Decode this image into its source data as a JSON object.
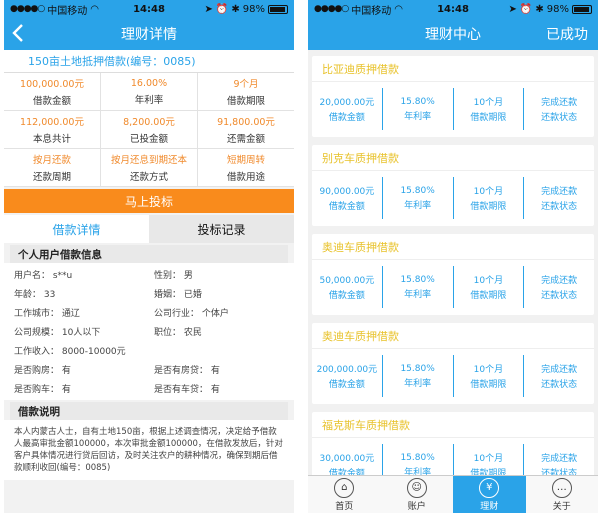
{
  "status": {
    "carrier": "中国移动",
    "time": "14:48",
    "battery": "98%"
  },
  "left": {
    "nav_title": "理财详情",
    "loan_title": "150亩土地抵押借款(编号：0085)",
    "stats": [
      [
        {
          "value": "100,000.00元",
          "label": "借款金额"
        },
        {
          "value": "16.00%",
          "label": "年利率"
        },
        {
          "value": "9个月",
          "label": "借款期限"
        }
      ],
      [
        {
          "value": "112,000.00元",
          "label": "本息共计"
        },
        {
          "value": "8,200.00元",
          "label": "已投金额"
        },
        {
          "value": "91,800.00元",
          "label": "还需金额"
        }
      ],
      [
        {
          "value": "按月还款",
          "label": "还款周期"
        },
        {
          "value": "按月还息到期还本",
          "label": "还款方式"
        },
        {
          "value": "短期周转",
          "label": "借款用途"
        }
      ]
    ],
    "invest_label": "马上投标",
    "tabs": [
      "借款详情",
      "投标记录"
    ],
    "info_title": "个人用户借款信息",
    "info_rows": [
      [
        "用户名：  s**u",
        "性别：  男"
      ],
      [
        "年龄：  33",
        "婚姻：  已婚"
      ],
      [
        "工作城市：  通辽",
        "公司行业：  个体户"
      ],
      [
        "公司规模：  10人以下",
        "职位：  农民"
      ],
      [
        "工作收入：  8000-10000元",
        ""
      ],
      [
        "是否购房：  有",
        "是否有房贷：  有"
      ],
      [
        "是否购车：  有",
        "是否有车贷：  有"
      ]
    ],
    "desc_title": "借款说明",
    "desc_text": "本人内蒙古人士，自有土地150亩，根据上述调查情况，决定给予借款人最高审批金额100000，本次审批金额100000，在借款发放后，针对客户具体情况进行贷后回访，及时关注农户的耕种情况，确保到期后借款顺利收回(编号：0085)"
  },
  "right": {
    "nav_title": "理财中心",
    "nav_right": "已成功",
    "cards": [
      {
        "title": "比亚迪质押借款",
        "amount": "20,000.00元",
        "amount_label": "借款金额",
        "rate": "15.80%",
        "rate_label": "年利率",
        "term": "10个月",
        "term_label": "借款期限",
        "status": "完成还款",
        "status_label": "还款状态"
      },
      {
        "title": "别克车质押借款",
        "amount": "90,000.00元",
        "amount_label": "借款金额",
        "rate": "15.80%",
        "rate_label": "年利率",
        "term": "10个月",
        "term_label": "借款期限",
        "status": "完成还款",
        "status_label": "还款状态"
      },
      {
        "title": "奥迪车质押借款",
        "amount": "50,000.00元",
        "amount_label": "借款金额",
        "rate": "15.80%",
        "rate_label": "年利率",
        "term": "10个月",
        "term_label": "借款期限",
        "status": "完成还款",
        "status_label": "还款状态"
      },
      {
        "title": "奥迪车质押借款",
        "amount": "200,000.00元",
        "amount_label": "借款金额",
        "rate": "15.80%",
        "rate_label": "年利率",
        "term": "10个月",
        "term_label": "借款期限",
        "status": "完成还款",
        "status_label": "还款状态"
      },
      {
        "title": "福克斯车质押借款",
        "amount": "30,000.00元",
        "amount_label": "借款金额",
        "rate": "15.80%",
        "rate_label": "年利率",
        "term": "10个月",
        "term_label": "借款期限",
        "status": "完成还款",
        "status_label": "还款状态"
      }
    ],
    "tabbar": [
      {
        "label": "首页",
        "icon": "home-icon"
      },
      {
        "label": "账户",
        "icon": "account-icon"
      },
      {
        "label": "理财",
        "icon": "finance-icon"
      },
      {
        "label": "关于",
        "icon": "chat-icon"
      }
    ],
    "active_tab": 2
  },
  "colors": {
    "primary": "#2aa3e8",
    "orange": "#f98b1c",
    "stat_value": "#f08a2c",
    "card_title": "#e8c22a"
  }
}
